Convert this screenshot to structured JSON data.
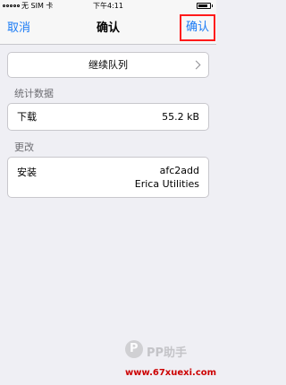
{
  "status_bar": {
    "carrier": "无 SIM 卡",
    "time": "下午4:11"
  },
  "nav": {
    "cancel_label": "取消",
    "title": "确认",
    "confirm_label": "确认"
  },
  "queue": {
    "label": "继续队列",
    "icon": "chevron-right-icon"
  },
  "stats": {
    "header": "统计数据",
    "download_label": "下载",
    "download_value": "55.2 kB"
  },
  "changes": {
    "header": "更改",
    "install_label": "安装",
    "package": "afc2add",
    "author": "Erica Utilities"
  },
  "watermark": {
    "logo_letter": "P",
    "brand": "PP助手",
    "url": "www.67xuexi.com"
  },
  "colors": {
    "accent": "#1a7bf5",
    "highlight_border": "#ff1a1a",
    "background": "#efeff4"
  }
}
